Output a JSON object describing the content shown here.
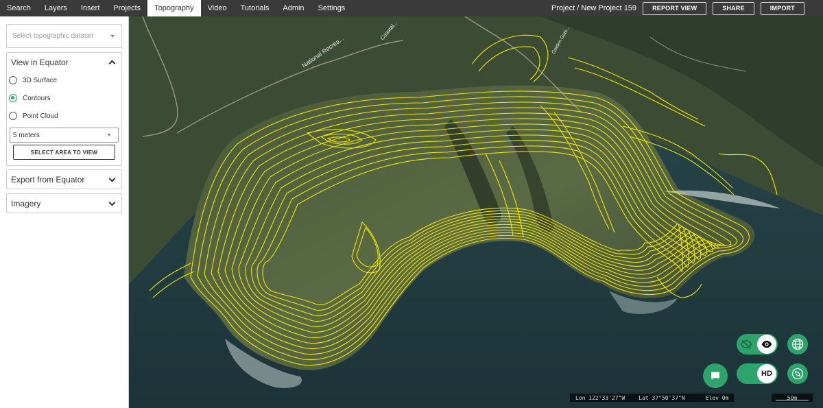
{
  "menu": {
    "items": [
      {
        "label": "Search"
      },
      {
        "label": "Layers"
      },
      {
        "label": "Insert"
      },
      {
        "label": "Projects"
      },
      {
        "label": "Topography",
        "active": true
      },
      {
        "label": "Video"
      },
      {
        "label": "Tutorials"
      },
      {
        "label": "Admin"
      },
      {
        "label": "Settings"
      }
    ]
  },
  "header": {
    "project_title": "Project / New Project 159",
    "report_view_label": "REPORT VIEW",
    "share_label": "SHARE",
    "import_label": "IMPORT"
  },
  "sidebar": {
    "dataset_placeholder": "Select topographic dataset",
    "view_panel": {
      "title": "View in Equator",
      "options": [
        {
          "label": "3D Surface",
          "checked": false
        },
        {
          "label": "Contours",
          "checked": true
        },
        {
          "label": "Point Cloud",
          "checked": false
        }
      ],
      "interval_value": "5 meters",
      "select_area_label": "SELECT AREA TO VIEW"
    },
    "export_panel": {
      "title": "Export from Equator"
    },
    "imagery_panel": {
      "title": "Imagery"
    }
  },
  "map": {
    "labels": {
      "road_label_1": "National Recrea...",
      "road_label_2": "Coastal...",
      "road_label_3": "Golden Gate..."
    },
    "controls": {
      "hd_label": "HD"
    },
    "status": {
      "lon": "Lon 122°33'27\"W",
      "lat": "Lat 37°50'37\"N",
      "elev": "Elev 0m",
      "scale": "50m"
    }
  },
  "colors": {
    "accent": "#2ea36b",
    "contour": "#f2e600",
    "topbar": "#3a3a3a"
  }
}
